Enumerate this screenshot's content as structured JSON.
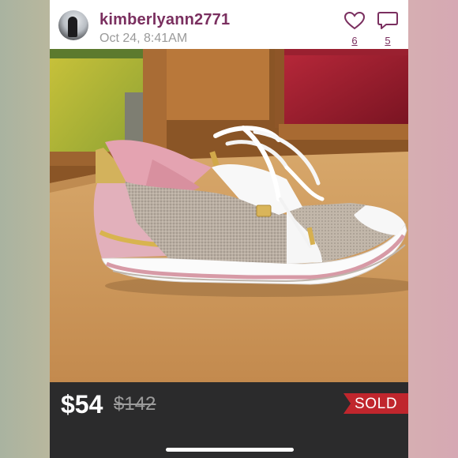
{
  "post": {
    "username": "kimberlyann2771",
    "timestamp": "Oct 24, 8:41AM",
    "likes": "6",
    "comments": "5"
  },
  "listing": {
    "price": "$54",
    "original_price": "$142",
    "status": "SOLD"
  },
  "icons": {
    "like": "heart-outline-icon",
    "comment": "speech-bubble-icon"
  },
  "colors": {
    "username": "#7a2f5f",
    "price_bar": "#2b2b2c",
    "sold_badge": "#c0262d"
  }
}
